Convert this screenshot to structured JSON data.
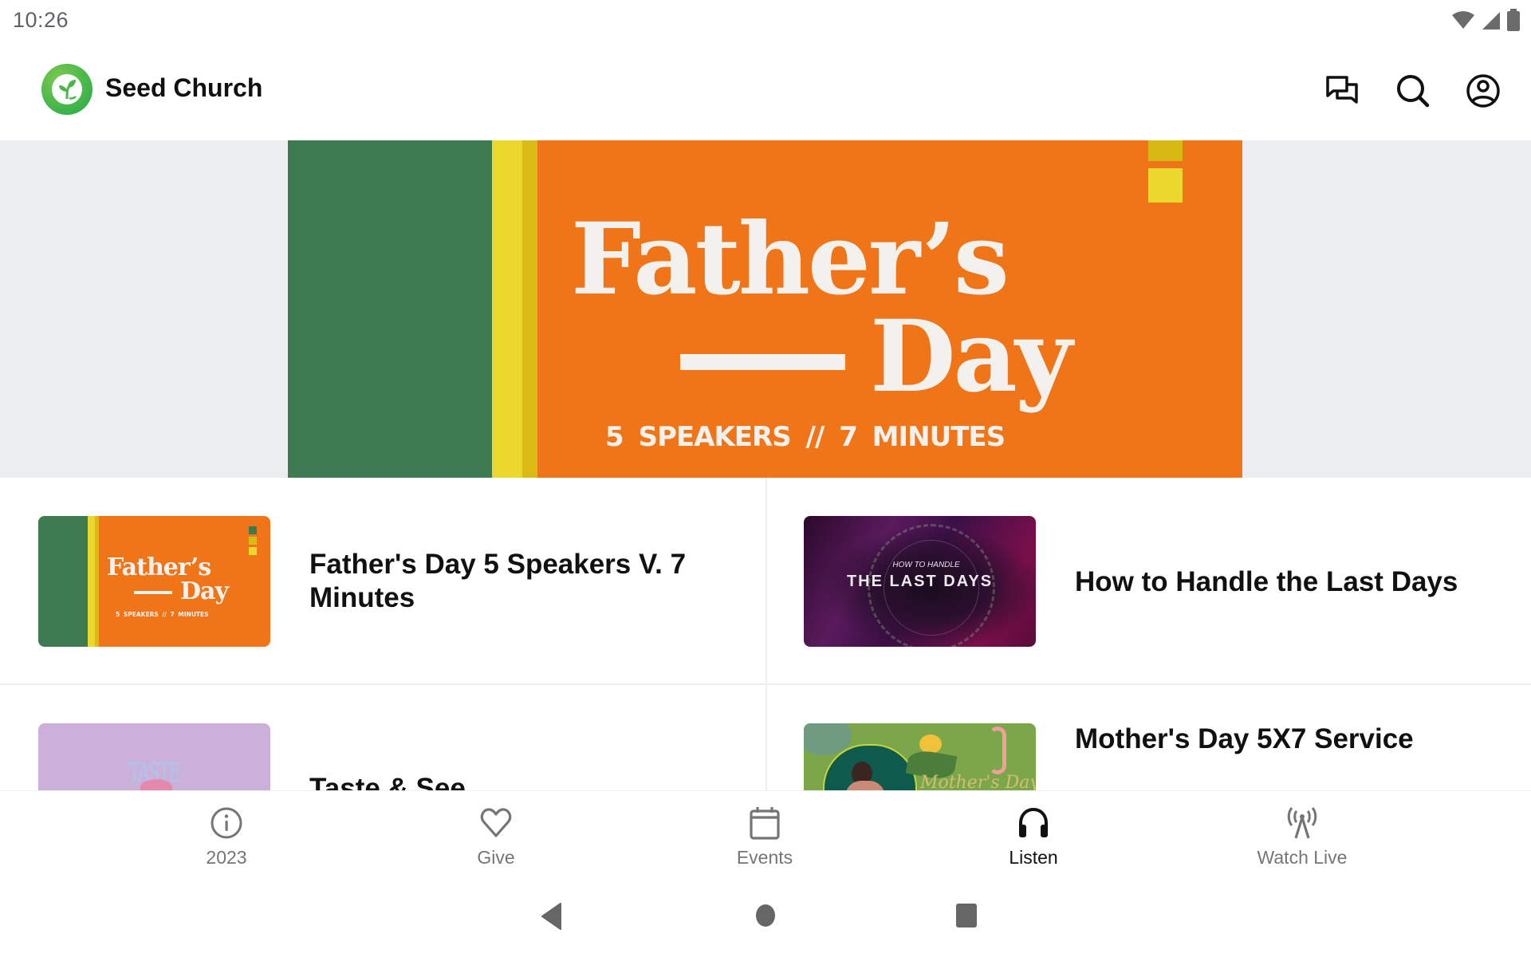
{
  "status_bar": {
    "time": "10:26",
    "icons": [
      "wifi-icon",
      "cell-signal-icon",
      "battery-icon"
    ]
  },
  "header": {
    "app_title": "Seed Church",
    "logo_icon": "seed-sprout-icon",
    "actions": [
      {
        "name": "messages",
        "icon": "chat-bubbles-icon"
      },
      {
        "name": "search",
        "icon": "search-icon"
      },
      {
        "name": "account",
        "icon": "account-circle-icon"
      }
    ]
  },
  "hero": {
    "line1": "Father’s",
    "line2": "Day",
    "subtitle": "5 SPEAKERS // 7 MINUTES",
    "colors": {
      "orange": "#f07518",
      "green": "#3d7a50",
      "yellow": "#ecd72e",
      "dark_yellow": "#d9bb14"
    }
  },
  "items": [
    {
      "title": "Father's Day 5 Speakers V. 7 Minutes",
      "thumb": {
        "line1": "Father’s",
        "line2": "Day",
        "subtitle": "5 SPEAKERS // 7 MINUTES"
      }
    },
    {
      "title": "How to Handle the Last Days",
      "thumb": {
        "small": "HOW TO HANDLE",
        "big": "THE LAST DAYS"
      }
    },
    {
      "title": "Taste & See",
      "thumb": {
        "text": "TASTE"
      }
    },
    {
      "title": "Mother's Day 5X7 Service",
      "thumb": {
        "script": "Mother's Day"
      }
    }
  ],
  "bottom_nav": {
    "active": "Listen",
    "items": [
      {
        "label": "2023",
        "icon": "info-icon"
      },
      {
        "label": "Give",
        "icon": "heart-icon"
      },
      {
        "label": "Events",
        "icon": "calendar-icon"
      },
      {
        "label": "Listen",
        "icon": "headphones-icon"
      },
      {
        "label": "Watch Live",
        "icon": "broadcast-antenna-icon"
      }
    ]
  },
  "system_nav": {
    "buttons": [
      "back",
      "home",
      "recents"
    ]
  }
}
